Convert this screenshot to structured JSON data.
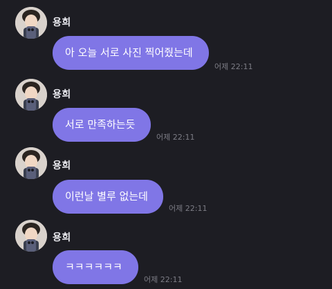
{
  "messages": [
    {
      "sender": "용희",
      "text": "아 오늘 서로 사진 찍어줬는데",
      "time": "어제 22:11"
    },
    {
      "sender": "용희",
      "text": "서로 만족하는듯",
      "time": "어제 22:11"
    },
    {
      "sender": "용희",
      "text": "이런날 별루 없는데",
      "time": "어제 22:11"
    },
    {
      "sender": "용희",
      "text": "ㅋㅋㅋㅋㅋㅋ",
      "time": "어제 22:11"
    }
  ],
  "colors": {
    "background": "#1d1d23",
    "bubble": "#8076e6",
    "sender_text": "#e9e9ee",
    "time_text": "#7d7d86"
  },
  "icons": {
    "avatar": "profile-photo"
  }
}
